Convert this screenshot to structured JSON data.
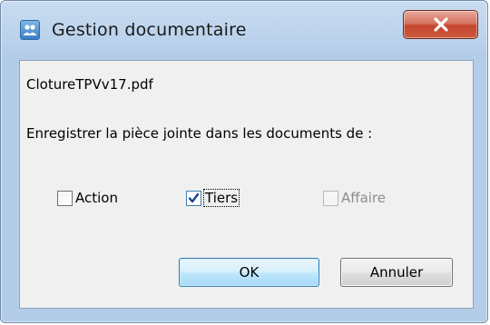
{
  "window": {
    "title": "Gestion documentaire",
    "close_icon": "close-x-icon",
    "app_icon": "users-group-icon"
  },
  "content": {
    "filename": "ClotureTPVv17.pdf",
    "prompt": "Enregistrer la pièce jointe dans les documents de :"
  },
  "options": [
    {
      "label": "Action",
      "checked": false,
      "enabled": true
    },
    {
      "label": "Tiers",
      "checked": true,
      "enabled": true,
      "focused": true
    },
    {
      "label": "Affaire",
      "checked": false,
      "enabled": false
    }
  ],
  "buttons": {
    "ok_label": "OK",
    "cancel_label": "Annuler"
  },
  "colors": {
    "titlebar": "#bcd3ec",
    "close_button": "#c4452d",
    "default_button_border": "#3c7fb1",
    "client_background": "#f0f0f0"
  }
}
